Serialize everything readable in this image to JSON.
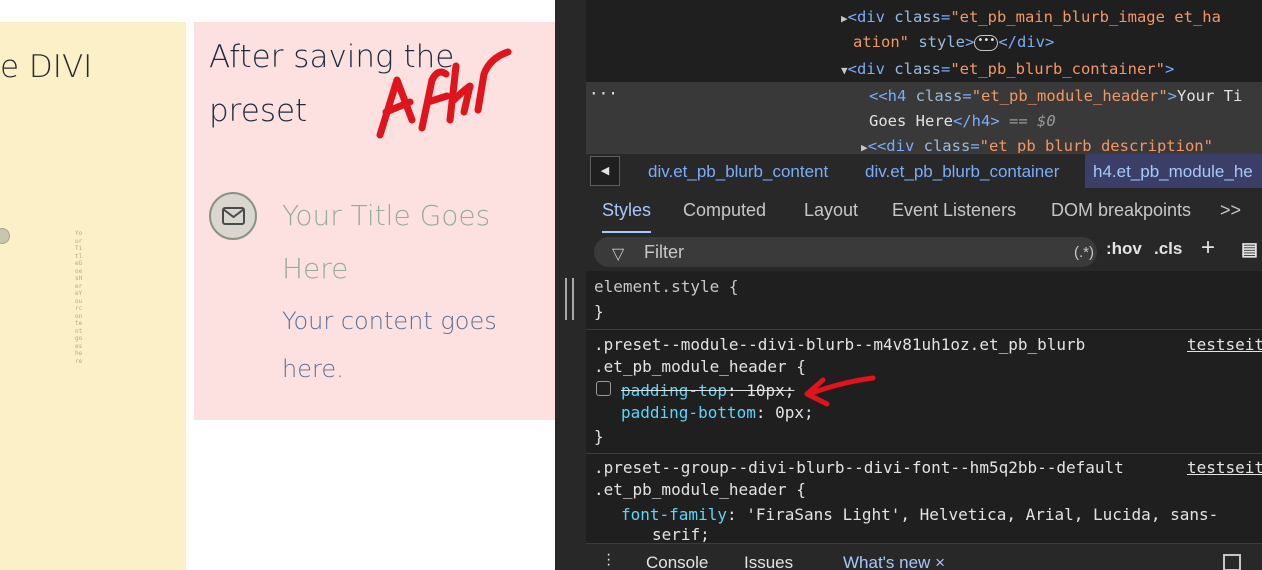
{
  "page": {
    "left_heading": "e DIVI",
    "right_heading": "After saving the preset",
    "annotation_after": "After",
    "vertical_text": "YourTitleGoesHereYourcontentgoeshere",
    "blurb_title": "Your Title Goes Here",
    "blurb_desc": "Your content goes here."
  },
  "devtools": {
    "elements": {
      "line1_tag_open": "<div ",
      "line1_attr": "class",
      "line1_val": "\"et_pb_main_blurb_image et_ha",
      "line2_val": "ation\"",
      "line2_attr": " style",
      "line2_end": "</div>",
      "line3_tag": "<div ",
      "line3_attr": "class",
      "line3_val": "\"et_pb_blurb_container\"",
      "line3_close": ">",
      "line4_tag": "<h4 ",
      "line4_attr": "class",
      "line4_val": "\"et_pb_module_header\"",
      "line4_text": "Your Ti",
      "line5_text": "Goes Here",
      "line5_close": "</h4>",
      "line5_eq": " == $0",
      "line6_tag": "<div ",
      "line6_attr": "class",
      "line6_val": "\"et_pb_blurb_description\"",
      "ellipsis": "···"
    },
    "breadcrumbs": [
      {
        "label": "div.et_pb_blurb_content"
      },
      {
        "label": "div.et_pb_blurb_container"
      },
      {
        "label": "h4.et_pb_module_he"
      }
    ],
    "tabs": [
      {
        "label": "Styles"
      },
      {
        "label": "Computed"
      },
      {
        "label": "Layout"
      },
      {
        "label": "Event Listeners"
      },
      {
        "label": "DOM breakpoints"
      },
      {
        "label": ">>"
      }
    ],
    "filter": {
      "placeholder": "Filter",
      "regex": "(.*)",
      "hov": ":hov",
      "cls": ".cls",
      "plus": "+"
    },
    "rules": {
      "element_style": "element.style {",
      "close": "}",
      "rule1_sel1": ".preset--module--divi-blurb--m4v81uh1oz.et_pb_blurb",
      "rule1_sel2": ".et_pb_module_header {",
      "rule1_src": "testseit",
      "rule1_p1_name": "padding-top",
      "rule1_p1_val": ": 10px;",
      "rule1_p2_name": "padding-bottom",
      "rule1_p2_val": ": 0px;",
      "rule2_sel1": ".preset--group--divi-blurb--divi-font--hm5q2bb--default",
      "rule2_sel2": ".et_pb_module_header {",
      "rule2_src": "testseit",
      "rule2_p1_name": "font-family",
      "rule2_p1_val": ": 'FiraSans Light', Helvetica, Arial, Lucida, sans-",
      "rule2_p1_cont": "serif;"
    },
    "drawer": {
      "console": "Console",
      "issues": "Issues",
      "whats_new": "What's new",
      "close": "×"
    }
  },
  "colors": {
    "yellow_column": "#fbf0c7",
    "pink_column": "#fde1e1",
    "annotation_red": "#e0141b",
    "devtools_bg": "#1f1f1f",
    "css_property": "#5cd5fb",
    "tag": "#7cacf8"
  }
}
